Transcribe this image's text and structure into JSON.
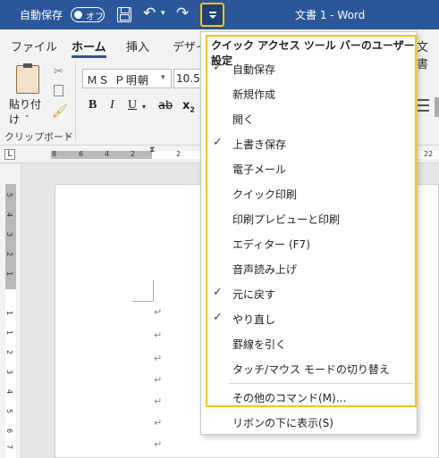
{
  "titlebar": {
    "autosave_label": "自動保存",
    "autosave_toggle": "オフ",
    "undo_icon": "↶",
    "redo_icon": "↷",
    "title": "文書 1  -  Word"
  },
  "ribbon": {
    "tabs": [
      "ファイル",
      "ホーム",
      "挿入",
      "デザイ"
    ],
    "tab_right": "文書",
    "paste_label": "貼り付け",
    "clipboard_label": "クリップボード",
    "font_name": "ＭＳ Ｐ明朝",
    "font_size": "10.5",
    "bold": "B",
    "italic": "I",
    "underline": "U",
    "strike": "ab",
    "subscript_base": "x",
    "subscript_sub": "2"
  },
  "ruler": {
    "tab_selector": "L",
    "h_numbers": [
      "8",
      "6",
      "4",
      "2",
      "2",
      "22"
    ],
    "v_numbers": [
      "5",
      "4",
      "3",
      "2",
      "1",
      "1",
      "1",
      "2",
      "3",
      "4",
      "5",
      "6",
      "7"
    ]
  },
  "document": {
    "paragraph_mark": "↵",
    "paragraph_count": 8
  },
  "qat_menu": {
    "header": "クイック アクセス ツール バーのユーザー設定",
    "items": [
      {
        "label": "自動保存",
        "checked": true
      },
      {
        "label": "新規作成",
        "checked": false
      },
      {
        "label": "開く",
        "checked": false
      },
      {
        "label": "上書き保存",
        "checked": true
      },
      {
        "label": "電子メール",
        "checked": false
      },
      {
        "label": "クイック印刷",
        "checked": false
      },
      {
        "label": "印刷プレビューと印刷",
        "checked": false
      },
      {
        "label": "エディター (F7)",
        "checked": false
      },
      {
        "label": "音声読み上げ",
        "checked": false
      },
      {
        "label": "元に戻す",
        "checked": true
      },
      {
        "label": "やり直し",
        "checked": true
      },
      {
        "label": "罫線を引く",
        "checked": false
      },
      {
        "label": "タッチ/マウス モードの切り替え",
        "checked": false
      },
      {
        "label": "その他のコマンド(M)...",
        "checked": false
      }
    ],
    "footer": "リボンの下に表示(S)",
    "check_glyph": "✓"
  },
  "colors": {
    "titlebar": "#2b579a",
    "highlight": "#f5c518"
  }
}
